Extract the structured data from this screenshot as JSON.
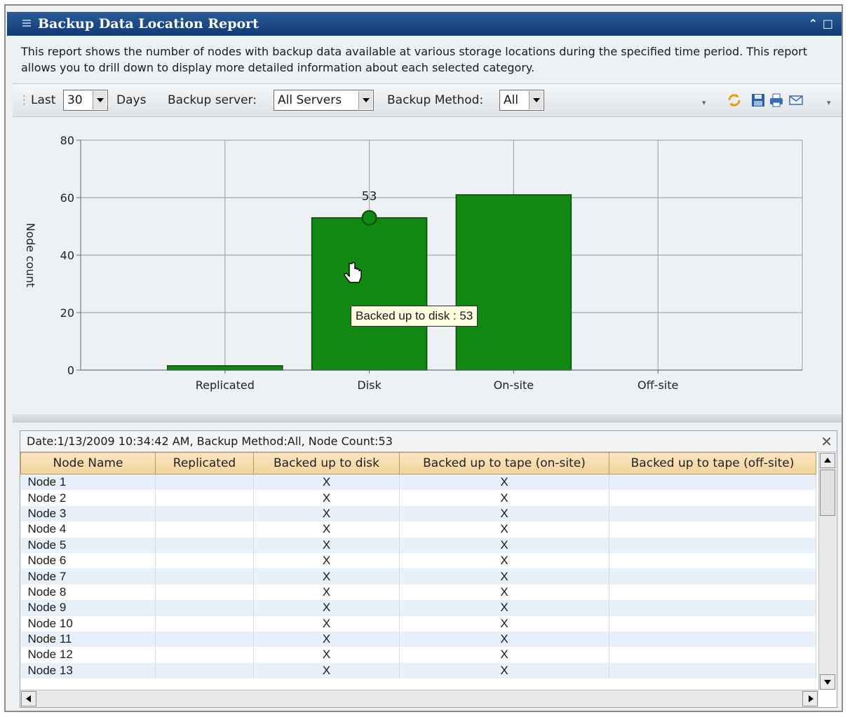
{
  "window": {
    "title": "Backup Data Location Report",
    "description": "This report shows the number of nodes with backup data available at various storage locations during the specified time period. This report allows you to drill down to display more detailed information about each selected category."
  },
  "toolbar": {
    "last_label": "Last",
    "days_value": "30",
    "days_label": "Days",
    "server_label": "Backup server:",
    "server_value": "All Servers",
    "method_label": "Backup Method:",
    "method_value": "All",
    "icons": [
      "refresh-icon",
      "save-icon",
      "print-icon",
      "email-icon"
    ]
  },
  "tooltip": {
    "text": "Backed up to disk : 53"
  },
  "chart_data": {
    "type": "bar",
    "categories": [
      "Replicated",
      "Disk",
      "On-site",
      "Off-site"
    ],
    "values": [
      1.5,
      53,
      61,
      0
    ],
    "ylabel": "Node count",
    "xlabel": "",
    "ylim": [
      0,
      80
    ],
    "yticks": [
      0,
      20,
      40,
      60,
      80
    ],
    "grid": true,
    "bar_color": "#118811",
    "highlighted": {
      "category": "Disk",
      "label": "53"
    }
  },
  "grid": {
    "caption": "Date:1/13/2009 10:34:42 AM, Backup Method:All, Node Count:53",
    "columns": [
      "Node Name",
      "Replicated",
      "Backed up to disk",
      "Backed up to tape (on-site)",
      "Backed up to tape (off-site)"
    ],
    "rows": [
      [
        "Node 1",
        "",
        "X",
        "X",
        ""
      ],
      [
        "Node 2",
        "",
        "X",
        "X",
        ""
      ],
      [
        "Node 3",
        "",
        "X",
        "X",
        ""
      ],
      [
        "Node 4",
        "",
        "X",
        "X",
        ""
      ],
      [
        "Node 5",
        "",
        "X",
        "X",
        ""
      ],
      [
        "Node 6",
        "",
        "X",
        "X",
        ""
      ],
      [
        "Node 7",
        "",
        "X",
        "X",
        ""
      ],
      [
        "Node 8",
        "",
        "X",
        "X",
        ""
      ],
      [
        "Node 9",
        "",
        "X",
        "X",
        ""
      ],
      [
        "Node 10",
        "",
        "X",
        "X",
        ""
      ],
      [
        "Node 11",
        "",
        "X",
        "X",
        ""
      ],
      [
        "Node 12",
        "",
        "X",
        "X",
        ""
      ],
      [
        "Node 13",
        "",
        "X",
        "X",
        ""
      ]
    ]
  }
}
